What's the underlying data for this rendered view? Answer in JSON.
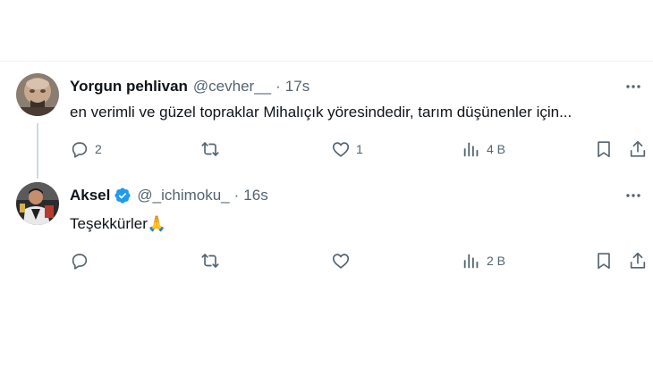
{
  "tweets": [
    {
      "name": "Yorgun pehlivan",
      "handle": "@cevher__",
      "separator": "·",
      "time": "17s",
      "verified": false,
      "text": "en verimli ve güzel topraklar Mihalıçık yöresindedir, tarım düşünenler için...",
      "counts": {
        "reply": "2",
        "retweet": "",
        "like": "1",
        "views": "4 B"
      }
    },
    {
      "name": "Aksel",
      "handle": "@_ichimoku_",
      "separator": "·",
      "time": "16s",
      "verified": true,
      "text": "Teşekkürler🙏",
      "counts": {
        "reply": "",
        "retweet": "",
        "like": "",
        "views": "2 B"
      }
    }
  ],
  "colors": {
    "text_primary": "#0f1419",
    "text_secondary": "#536471",
    "verified_blue": "#1d9bf0",
    "thread_line": "#cfd9de",
    "divider": "#eff3f4"
  },
  "icons": [
    "more-icon",
    "reply-icon",
    "retweet-icon",
    "like-icon",
    "views-icon",
    "bookmark-icon",
    "share-icon",
    "verified-icon"
  ]
}
